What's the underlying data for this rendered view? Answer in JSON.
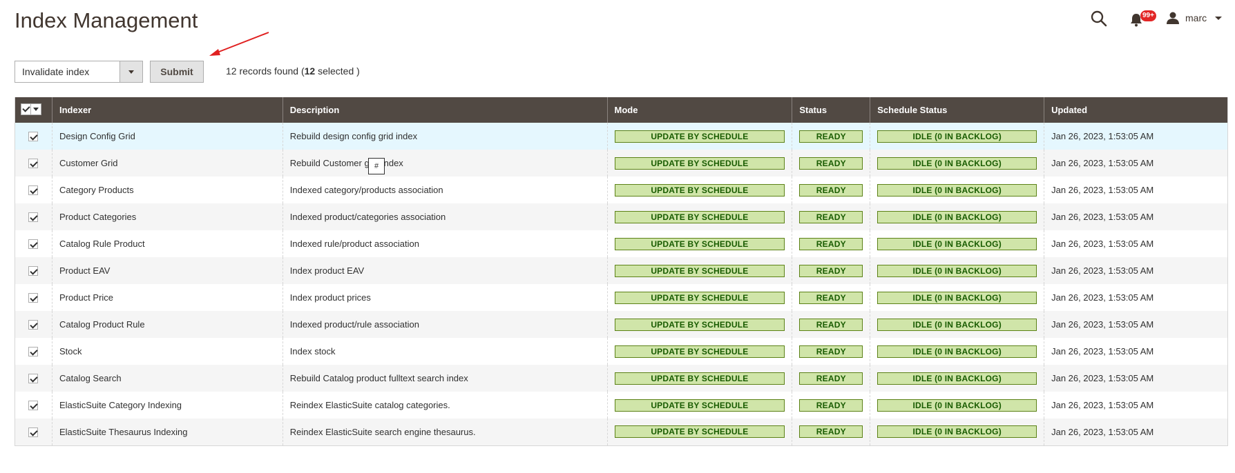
{
  "page": {
    "title": "Index Management"
  },
  "header": {
    "notifications_count": "99+",
    "user_name": "marc"
  },
  "actions": {
    "select_value": "Invalidate index",
    "submit_label": "Submit",
    "records_prefix": "12 records found (",
    "records_selected_count": "12",
    "records_suffix": " selected )"
  },
  "grid": {
    "columns": [
      "Indexer",
      "Description",
      "Mode",
      "Status",
      "Schedule Status",
      "Updated"
    ],
    "rows": [
      {
        "indexer": "Design Config Grid",
        "description": "Rebuild design config grid index",
        "mode": "UPDATE BY SCHEDULE",
        "status": "READY",
        "schedule": "IDLE (0 IN BACKLOG)",
        "updated": "Jan 26, 2023, 1:53:05 AM"
      },
      {
        "indexer": "Customer Grid",
        "description": "Rebuild Customer grid index",
        "mode": "UPDATE BY SCHEDULE",
        "status": "READY",
        "schedule": "IDLE (0 IN BACKLOG)",
        "updated": "Jan 26, 2023, 1:53:05 AM"
      },
      {
        "indexer": "Category Products",
        "description": "Indexed category/products association",
        "mode": "UPDATE BY SCHEDULE",
        "status": "READY",
        "schedule": "IDLE (0 IN BACKLOG)",
        "updated": "Jan 26, 2023, 1:53:05 AM"
      },
      {
        "indexer": "Product Categories",
        "description": "Indexed product/categories association",
        "mode": "UPDATE BY SCHEDULE",
        "status": "READY",
        "schedule": "IDLE (0 IN BACKLOG)",
        "updated": "Jan 26, 2023, 1:53:05 AM"
      },
      {
        "indexer": "Catalog Rule Product",
        "description": "Indexed rule/product association",
        "mode": "UPDATE BY SCHEDULE",
        "status": "READY",
        "schedule": "IDLE (0 IN BACKLOG)",
        "updated": "Jan 26, 2023, 1:53:05 AM"
      },
      {
        "indexer": "Product EAV",
        "description": "Index product EAV",
        "mode": "UPDATE BY SCHEDULE",
        "status": "READY",
        "schedule": "IDLE (0 IN BACKLOG)",
        "updated": "Jan 26, 2023, 1:53:05 AM"
      },
      {
        "indexer": "Product Price",
        "description": "Index product prices",
        "mode": "UPDATE BY SCHEDULE",
        "status": "READY",
        "schedule": "IDLE (0 IN BACKLOG)",
        "updated": "Jan 26, 2023, 1:53:05 AM"
      },
      {
        "indexer": "Catalog Product Rule",
        "description": "Indexed product/rule association",
        "mode": "UPDATE BY SCHEDULE",
        "status": "READY",
        "schedule": "IDLE (0 IN BACKLOG)",
        "updated": "Jan 26, 2023, 1:53:05 AM"
      },
      {
        "indexer": "Stock",
        "description": "Index stock",
        "mode": "UPDATE BY SCHEDULE",
        "status": "READY",
        "schedule": "IDLE (0 IN BACKLOG)",
        "updated": "Jan 26, 2023, 1:53:05 AM"
      },
      {
        "indexer": "Catalog Search",
        "description": "Rebuild Catalog product fulltext search index",
        "mode": "UPDATE BY SCHEDULE",
        "status": "READY",
        "schedule": "IDLE (0 IN BACKLOG)",
        "updated": "Jan 26, 2023, 1:53:05 AM"
      },
      {
        "indexer": "ElasticSuite Category Indexing",
        "description": "Reindex ElasticSuite catalog categories.",
        "mode": "UPDATE BY SCHEDULE",
        "status": "READY",
        "schedule": "IDLE (0 IN BACKLOG)",
        "updated": "Jan 26, 2023, 1:53:05 AM"
      },
      {
        "indexer": "ElasticSuite Thesaurus Indexing",
        "description": "Reindex ElasticSuite search engine thesaurus.",
        "mode": "UPDATE BY SCHEDULE",
        "status": "READY",
        "schedule": "IDLE (0 IN BACKLOG)",
        "updated": "Jan 26, 2023, 1:53:05 AM"
      }
    ]
  },
  "tooltip": {
    "text": "#"
  },
  "colors": {
    "header_bg": "#514943",
    "pill_bg": "#d0e5a9",
    "pill_border": "#5b8116",
    "pill_text": "#185b00",
    "badge": "#e22626",
    "annotation_arrow": "#e02020"
  },
  "icons": {
    "search": "search-icon",
    "notifications": "bell-icon",
    "user": "user-icon"
  }
}
